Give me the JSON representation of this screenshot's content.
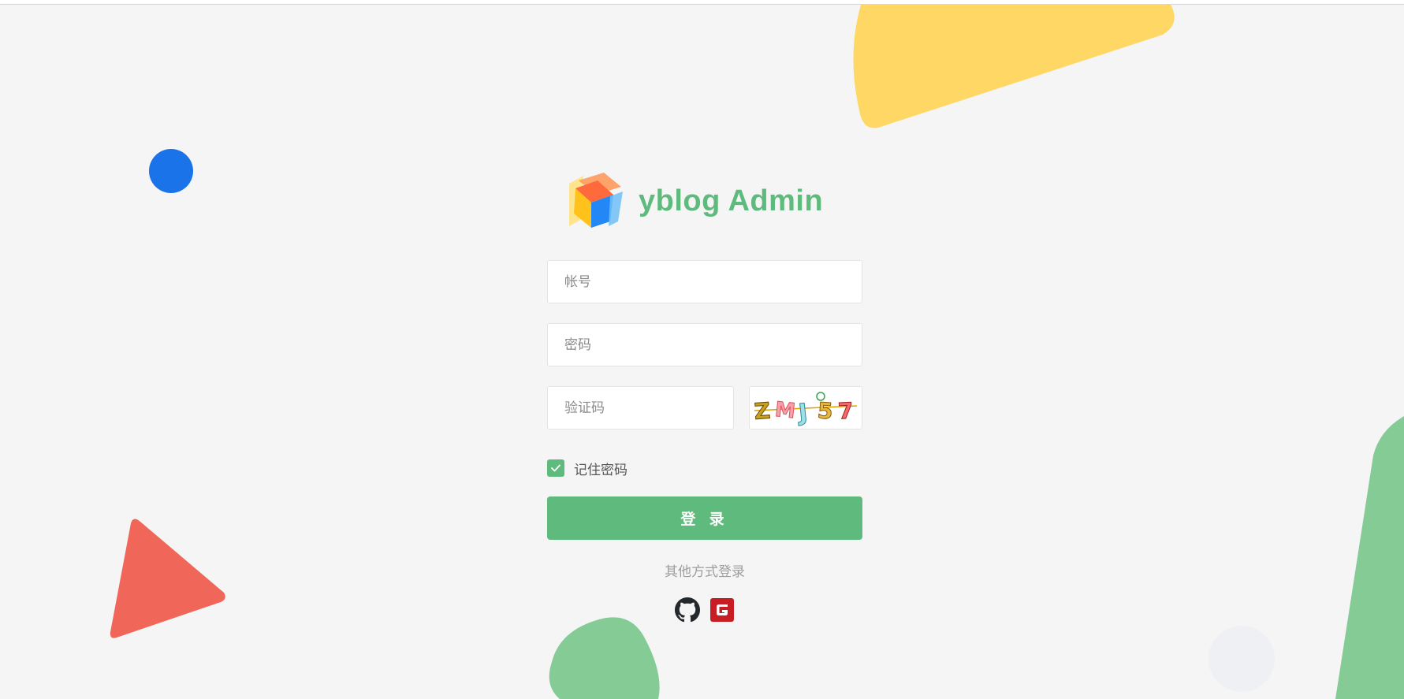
{
  "app": {
    "brand_title": "yblog Admin"
  },
  "form": {
    "account_placeholder": "帐号",
    "password_placeholder": "密码",
    "captcha_placeholder": "验证码",
    "captcha_text": "ZMJ57",
    "remember_label": "记住密码",
    "remember_checked": true,
    "login_label": "登 录",
    "other_login_label": "其他方式登录"
  },
  "social_logins": [
    {
      "name": "github-icon"
    },
    {
      "name": "gitee-icon"
    }
  ],
  "colors": {
    "accent": "#5fba7d",
    "background": "#f5f5f5",
    "decor_yellow": "#ffd764",
    "decor_blue": "#1a73e8",
    "decor_red": "#f0675a",
    "decor_green": "#84cb96",
    "gitee_red": "#c71d23"
  }
}
